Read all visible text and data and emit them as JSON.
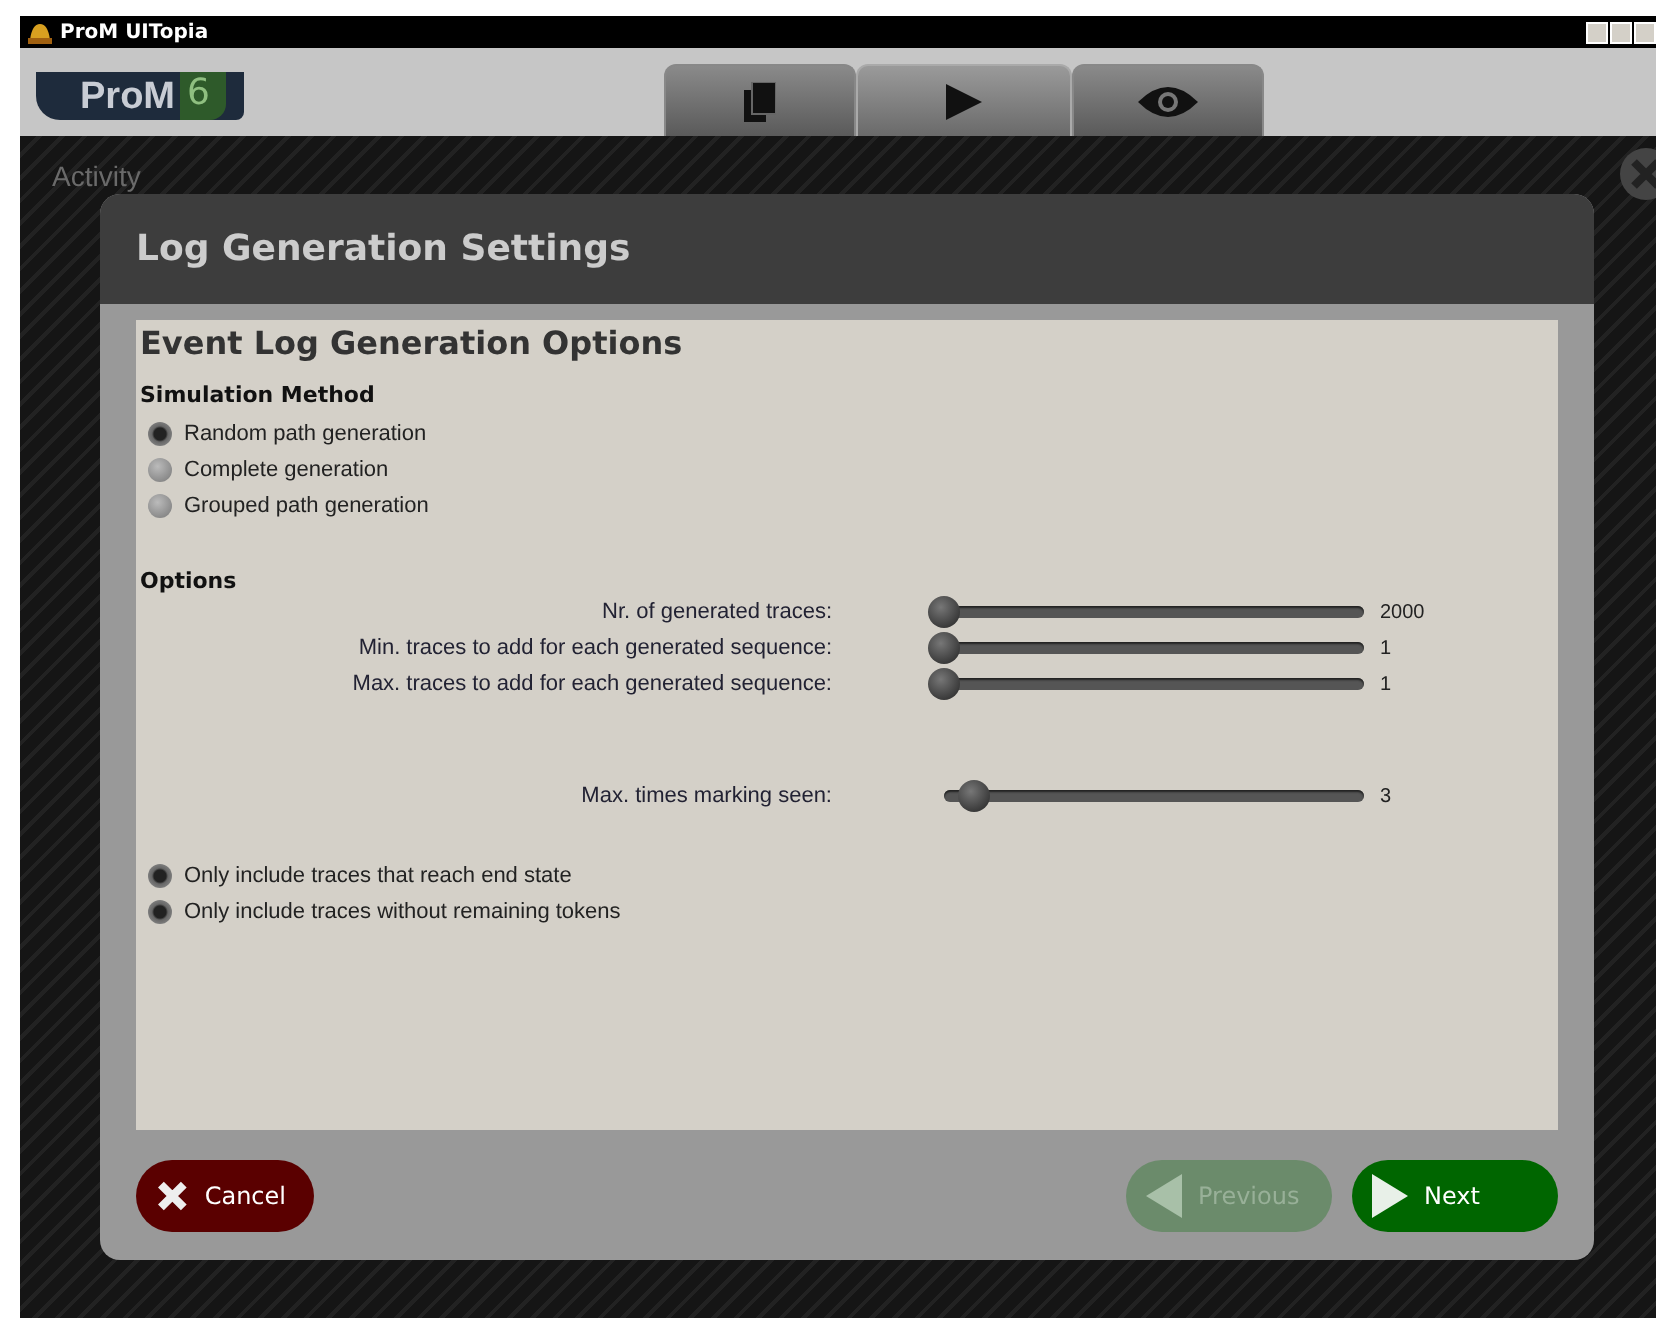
{
  "window": {
    "title": "ProM UITopia"
  },
  "logo": {
    "name": "ProM",
    "version": "6"
  },
  "tabs": [
    {
      "kind": "copy",
      "selected": false
    },
    {
      "kind": "play",
      "selected": true
    },
    {
      "kind": "view",
      "selected": false
    }
  ],
  "activity": {
    "label": "Activity"
  },
  "dialog": {
    "title": "Log Generation Settings",
    "heading": "Event Log Generation Options",
    "simulation": {
      "label": "Simulation Method",
      "options": [
        {
          "label": "Random path generation",
          "selected": true
        },
        {
          "label": "Complete generation",
          "selected": false
        },
        {
          "label": "Grouped path generation",
          "selected": false
        }
      ]
    },
    "options_label": "Options",
    "slider_groups": [
      [
        {
          "label": "Nr. of generated traces:",
          "level": 0,
          "reading": "2000"
        },
        {
          "label": "Min. traces to add for each generated sequence:",
          "level": 0,
          "reading": "1"
        },
        {
          "label": "Max. traces to add for each generated sequence:",
          "level": 0,
          "reading": "1"
        }
      ],
      [
        {
          "label": "Max. times marking seen:",
          "level": 0.07,
          "reading": "3"
        }
      ]
    ],
    "checks": [
      {
        "label": "Only include traces that reach end state",
        "checked": true
      },
      {
        "label": "Only include traces without remaining tokens",
        "checked": true
      }
    ],
    "buttons": [
      {
        "kind": "cancel",
        "label": "Cancel",
        "disabled": false
      },
      {
        "kind": "previous",
        "label": "Previous",
        "disabled": true
      },
      {
        "kind": "next",
        "label": "Next",
        "disabled": false
      }
    ]
  }
}
